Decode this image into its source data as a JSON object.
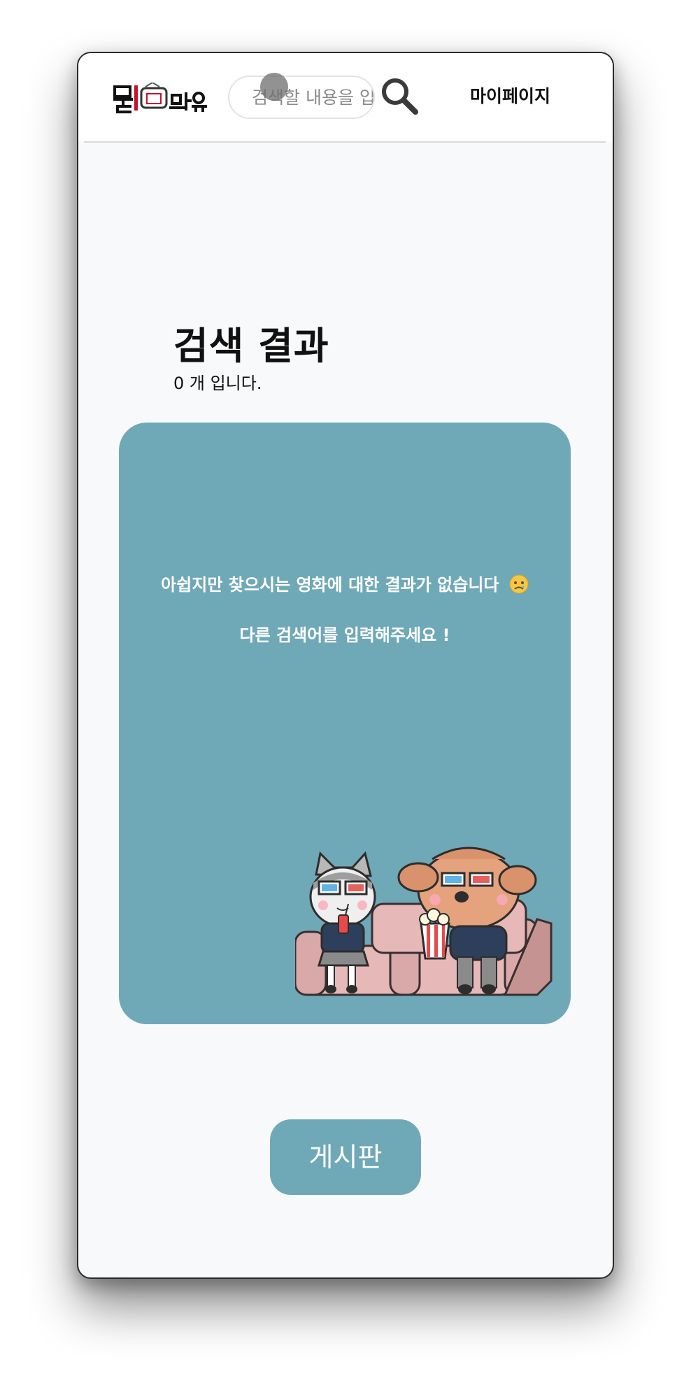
{
  "header": {
    "logo_text": "뭘 봐유",
    "search": {
      "placeholder": "검색할 내용을 입력하세요",
      "value": ""
    },
    "search_icon": "search-icon",
    "mypage_label": "마이페이지"
  },
  "main": {
    "title": "검색 결과",
    "count_text": "0 개 입니다.",
    "empty_state": {
      "message_line1": "아쉽지만 찾으시는 영화에 대한 결과가 없습니다",
      "message_emoji": "sad-face-emoji",
      "message_line2": "다른 검색어를 입력해주세요 !",
      "illustration": "cat-and-dog-watching-movie-illustration"
    },
    "board_button_label": "게시판"
  },
  "colors": {
    "accent": "#6fa8b7",
    "background": "#f8f9fa",
    "header_bg": "#ffffff",
    "text": "#111111",
    "logo_red": "#c8102e"
  }
}
